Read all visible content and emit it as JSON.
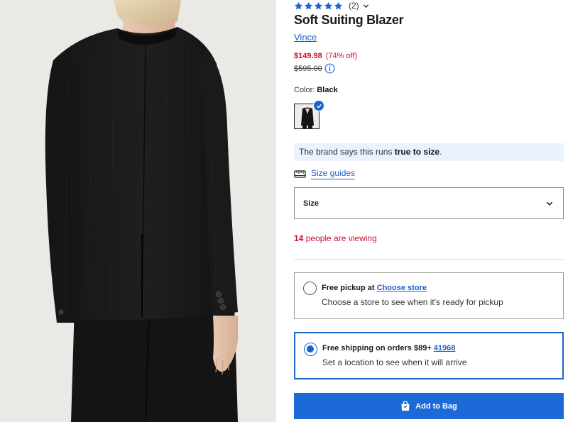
{
  "product": {
    "review_count": "(2)",
    "title": "Soft Suiting Blazer",
    "brand": "Vince",
    "sale_price": "$149.98",
    "discount": "(74% off)",
    "original_price": "$595.00",
    "rating_stars": 5
  },
  "color": {
    "label": "Color:",
    "value": "Black"
  },
  "fit_note": {
    "text": "The brand says this runs ",
    "bold": "true to size",
    "suffix": "."
  },
  "size_guides": {
    "label": "Size guides"
  },
  "size_select": {
    "label": "Size"
  },
  "viewing": {
    "count": "14",
    "text": " people are viewing"
  },
  "fulfillment": {
    "pickup": {
      "title": "Free pickup at ",
      "link": "Choose store",
      "subtitle": "Choose a store to see when it's ready for pickup",
      "selected": false
    },
    "shipping": {
      "title": "Free shipping on orders $89+ ",
      "link": "41968",
      "subtitle": "Set a location to see when it will arrive",
      "selected": true
    }
  },
  "add_to_bag": {
    "label": "Add to Bag"
  },
  "colors": {
    "accent": "#1b63cc",
    "sale": "#c8102e",
    "button": "#1b6ad8"
  },
  "icons": [
    "star-icon",
    "chevron-down-icon",
    "info-icon",
    "checkmark-icon",
    "size-guide-icon",
    "shopping-bag-icon"
  ]
}
